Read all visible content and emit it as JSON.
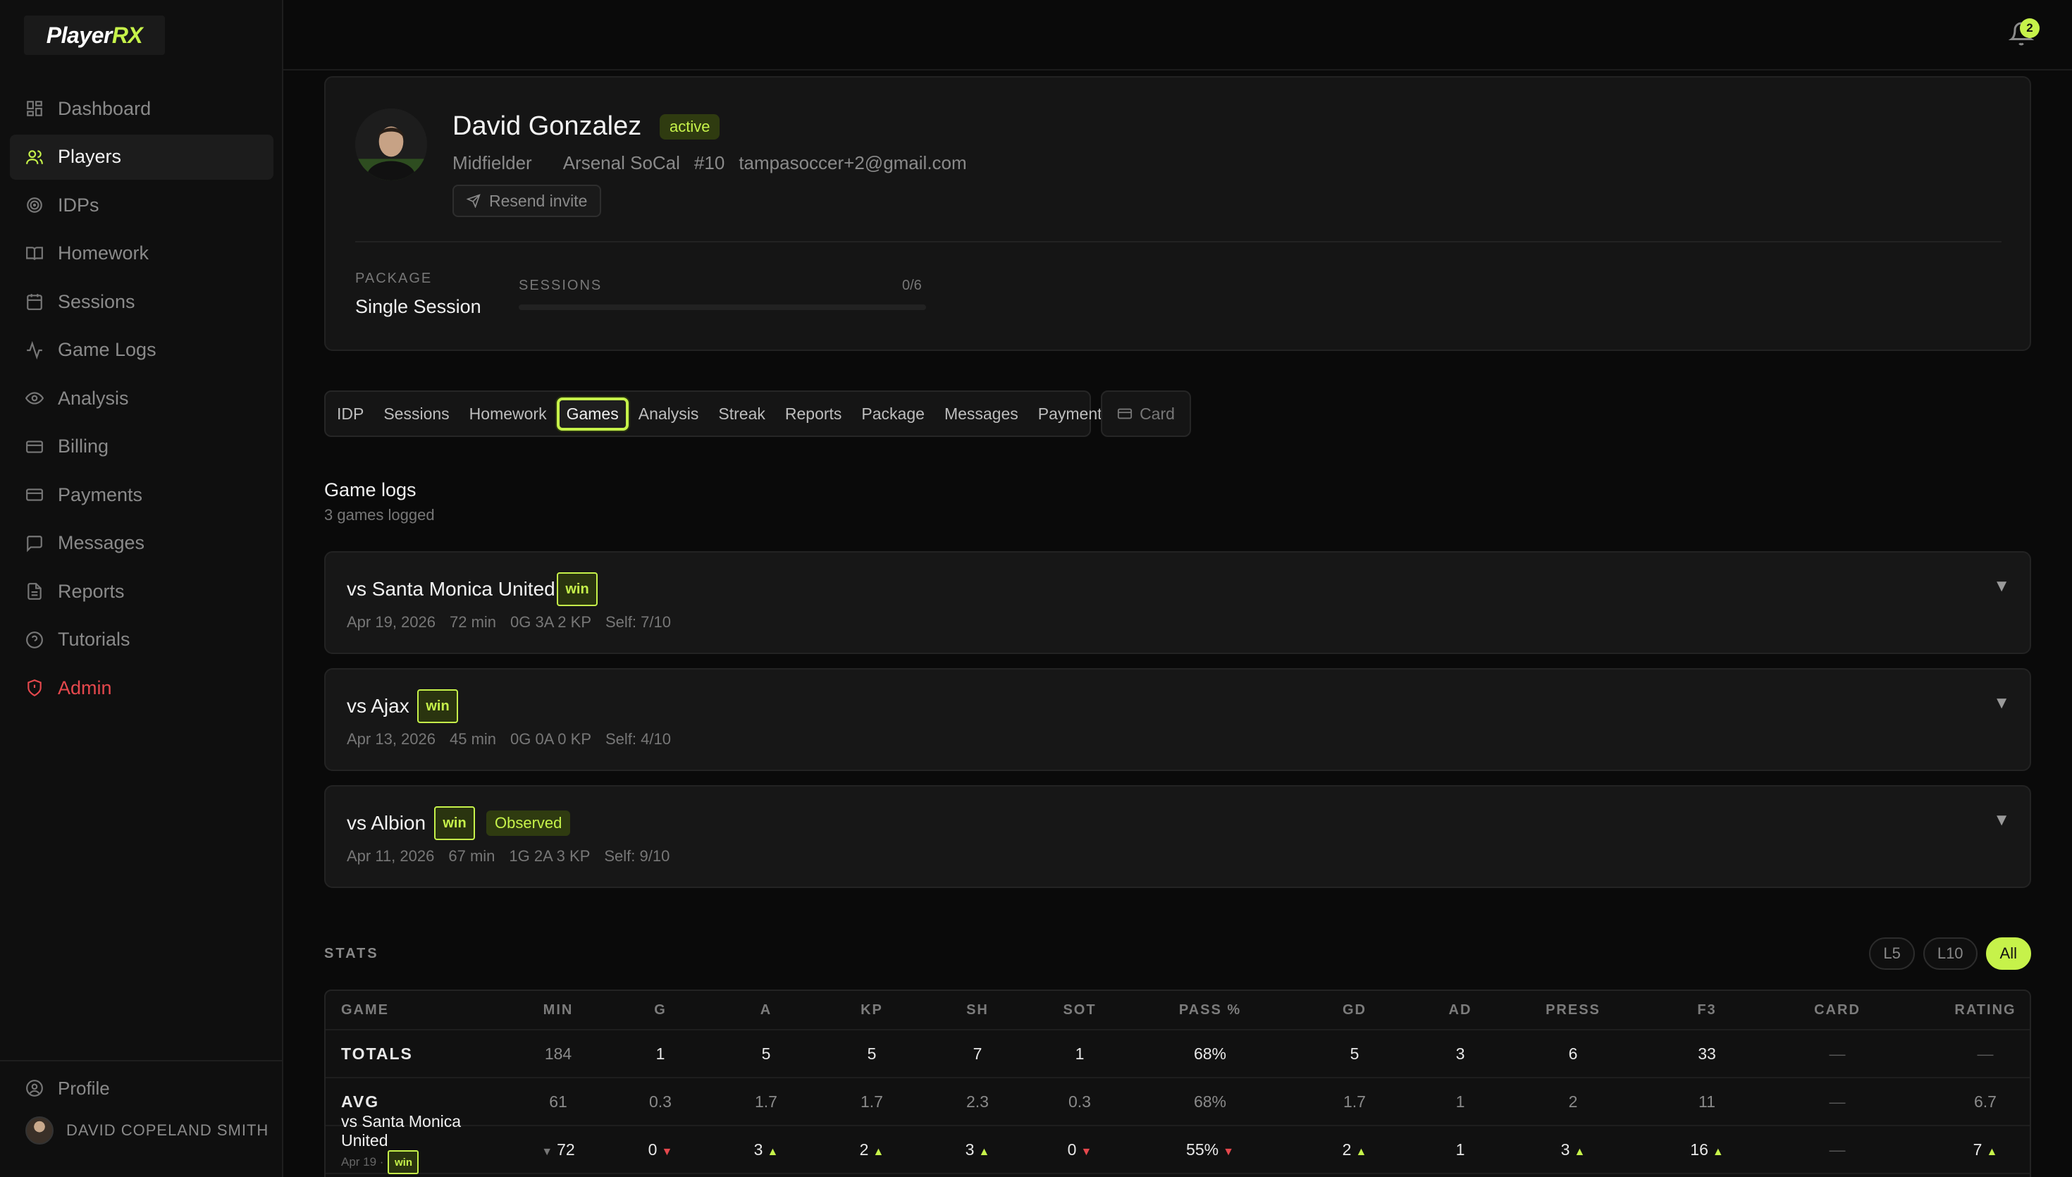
{
  "app": {
    "logo_player": "Player",
    "logo_rx": "RX",
    "notifications_count": "2"
  },
  "sidebar": {
    "items": [
      {
        "label": "Dashboard",
        "icon": "dashboard-icon"
      },
      {
        "label": "Players",
        "icon": "users-icon",
        "active": true
      },
      {
        "label": "IDPs",
        "icon": "target-icon"
      },
      {
        "label": "Homework",
        "icon": "book-icon"
      },
      {
        "label": "Sessions",
        "icon": "calendar-icon"
      },
      {
        "label": "Game Logs",
        "icon": "activity-icon"
      },
      {
        "label": "Analysis",
        "icon": "eye-icon"
      },
      {
        "label": "Billing",
        "icon": "card-icon"
      },
      {
        "label": "Payments",
        "icon": "card-icon"
      },
      {
        "label": "Messages",
        "icon": "message-icon"
      },
      {
        "label": "Reports",
        "icon": "file-icon"
      },
      {
        "label": "Tutorials",
        "icon": "help-icon"
      },
      {
        "label": "Admin",
        "icon": "shield-icon"
      }
    ],
    "profile_label": "Profile",
    "user_name": "DAVID COPELAND SMITH"
  },
  "player": {
    "name": "David Gonzalez",
    "status": "active",
    "position": "Midfielder",
    "team": "Arsenal SoCal",
    "number": "#10",
    "email": "tampasoccer+2@gmail.com",
    "resend_label": "Resend invite",
    "package_label": "PACKAGE",
    "package_value": "Single Session",
    "sessions_label": "SESSIONS",
    "sessions_count": "0/6",
    "sessions_progress": 0
  },
  "tabs": [
    "IDP",
    "Sessions",
    "Homework",
    "Games",
    "Analysis",
    "Streak",
    "Reports",
    "Package",
    "Messages",
    "Payments"
  ],
  "active_tab": "Games",
  "card_tab_label": "Card",
  "game_logs": {
    "title": "Game logs",
    "subtitle": "3 games logged",
    "games": [
      {
        "title": "vs Santa Monica United",
        "result": "win",
        "date": "Apr 19, 2026",
        "minutes": "72 min",
        "line": "0G 3A 2 KP",
        "self": "Self: 7/10",
        "observed": ""
      },
      {
        "title": "vs Ajax",
        "result": "win",
        "date": "Apr 13, 2026",
        "minutes": "45 min",
        "line": "0G 0A 0 KP",
        "self": "Self: 4/10",
        "observed": ""
      },
      {
        "title": "vs Albion",
        "result": "win",
        "date": "Apr 11, 2026",
        "minutes": "67 min",
        "line": "1G 2A 3 KP",
        "self": "Self: 9/10",
        "observed": "Observed"
      }
    ]
  },
  "stats": {
    "title": "STATS",
    "filters": [
      "L5",
      "L10",
      "All"
    ],
    "active_filter": "All",
    "columns": [
      "GAME",
      "MIN",
      "G",
      "A",
      "KP",
      "SH",
      "SOT",
      "PASS %",
      "GD",
      "AD",
      "PRESS",
      "F3",
      "CARD",
      "RATING"
    ],
    "totals": [
      "TOTALS",
      "184",
      "1",
      "5",
      "5",
      "7",
      "1",
      "68%",
      "5",
      "3",
      "6",
      "33",
      "—",
      "—"
    ],
    "avg": [
      "AVG",
      "61",
      "0.3",
      "1.7",
      "1.7",
      "2.3",
      "0.3",
      "68%",
      "1.7",
      "1",
      "2",
      "11",
      "—",
      "6.7"
    ],
    "first_game": {
      "title": "vs Santa Monica United",
      "date": "Apr 19 ·",
      "result": "win",
      "values": [
        "72",
        "0",
        "3",
        "2",
        "3",
        "0",
        "55%",
        "2",
        "1",
        "3",
        "16",
        "—",
        "7"
      ]
    }
  }
}
